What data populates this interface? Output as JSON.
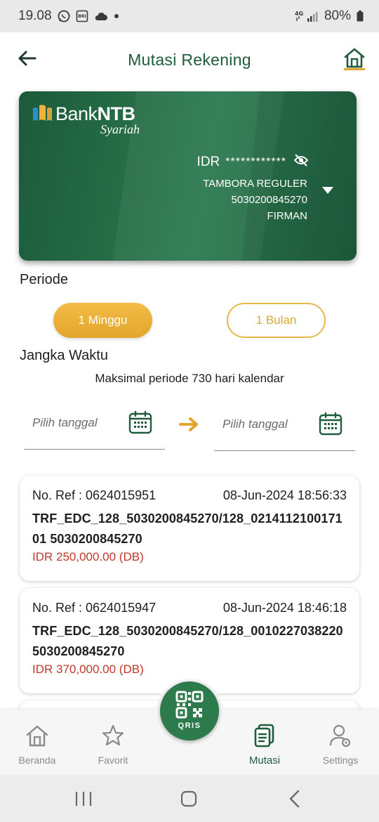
{
  "status_bar": {
    "time": "19.08",
    "network": "4G",
    "battery": "80%"
  },
  "header": {
    "title": "Mutasi Rekening",
    "back_icon": "back-arrow-icon",
    "home_icon": "home-icon"
  },
  "account_card": {
    "bank_name_light": "Bank",
    "bank_name_bold": "NTB",
    "bank_sub": "Syariah",
    "currency": "IDR",
    "balance_masked": "************",
    "account_type": "TAMBORA REGULER",
    "account_number": "5030200845270",
    "account_holder": "FIRMAN"
  },
  "periode": {
    "label": "Periode",
    "options": [
      "1 Minggu",
      "1 Bulan"
    ],
    "selected": "1 Minggu"
  },
  "jangka_waktu": {
    "label": "Jangka Waktu",
    "note": "Maksimal periode 730 hari kalendar",
    "start_placeholder": "Pilih tanggal",
    "end_placeholder": "Pilih tanggal"
  },
  "transactions": [
    {
      "ref": "No. Ref : 0624015951",
      "datetime": "08-Jun-2024 18:56:33",
      "description": "TRF_EDC_128_5030200845270/128_021411210017101 5030200845270",
      "amount": "IDR 250,000.00 (DB)"
    },
    {
      "ref": "No. Ref : 0624015947",
      "datetime": "08-Jun-2024 18:46:18",
      "description": "TRF_EDC_128_5030200845270/128_0010227038220 5030200845270",
      "amount": "IDR 370,000.00 (DB)"
    }
  ],
  "bottom_nav": {
    "items": [
      {
        "label": "Beranda",
        "icon": "home-icon"
      },
      {
        "label": "Favorit",
        "icon": "star-icon"
      },
      {
        "label": "Mutasi",
        "icon": "document-icon",
        "active": true
      },
      {
        "label": "Settings",
        "icon": "user-settings-icon"
      }
    ],
    "qris_label": "QRIS"
  },
  "colors": {
    "primary_green": "#1f5c3c",
    "card_green": "#266e48",
    "accent_gold": "#e8b94a",
    "debit_red": "#c0392b"
  }
}
